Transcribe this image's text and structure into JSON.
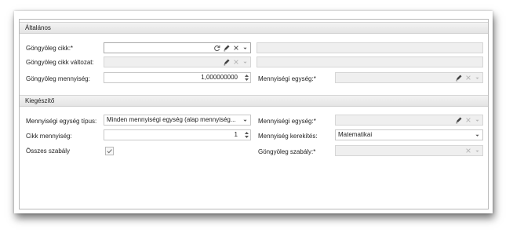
{
  "sections": {
    "general": {
      "title": "Általános"
    },
    "extra": {
      "title": "Kiegészítő"
    }
  },
  "general": {
    "item_label": "Göngyöleg cikk:*",
    "item_value": "",
    "item_variant_label": "Göngyöleg cikk változat:",
    "quantity_label": "Göngyöleg mennyiség:",
    "quantity_value": "1,000000000",
    "unit_label": "Mennyiségi egység:*",
    "unit_value": ""
  },
  "extra": {
    "unit_type_label": "Mennyiségi egység típus:",
    "unit_type_value": "Minden mennyiségi egység (alap mennyiség...",
    "unit_label": "Mennyiségi egység:*",
    "item_qty_label": "Cikk mennyiség:",
    "item_qty_value": "1",
    "rounding_label": "Mennyiség kerekítés:",
    "rounding_value": "Matematikai",
    "all_rules_label": "Összes szabály",
    "all_rules_checked": true,
    "packaging_rule_label": "Göngyöleg szabály:*"
  }
}
